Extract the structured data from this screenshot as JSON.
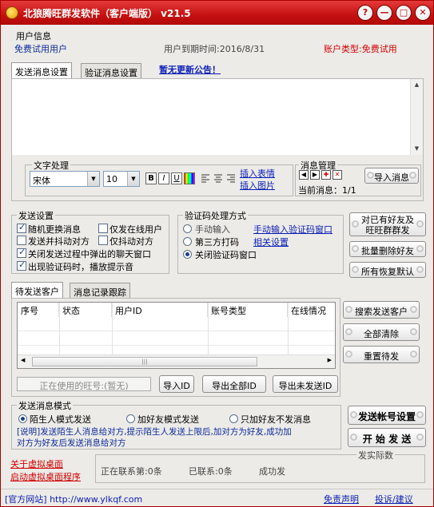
{
  "window": {
    "title": "北狼腾旺群发软件（客户端版）  v21.5",
    "controls": [
      "?",
      "—",
      "□",
      "✕"
    ]
  },
  "user_info": {
    "heading": "用户信息",
    "user": "免费试用用户",
    "expiry": "用户到期时间:2016/8/31",
    "account_type": "账户类型:免费试用"
  },
  "msg_tabs": [
    {
      "label": "发送消息设置",
      "active": true
    },
    {
      "label": "验证消息设置",
      "active": false
    }
  ],
  "announcement": "暂无更新公告！",
  "message_body": "",
  "text_format": {
    "heading": "文字处理",
    "font": "宋体",
    "size": "10",
    "buttons": [
      "B",
      "I",
      "U"
    ],
    "insert_emoji": "插入表情",
    "insert_image": "插入图片"
  },
  "msg_manage": {
    "heading": "消息管理",
    "import_button": "导入消息",
    "current": "当前消息：1/1"
  },
  "send_settings": {
    "heading": "发送设置",
    "options": [
      {
        "label": "随机更换消息",
        "checked": true
      },
      {
        "label": "仅发在线用户",
        "checked": false
      },
      {
        "label": "发送并抖动对方",
        "checked": false
      },
      {
        "label": "仅抖动对方",
        "checked": false
      },
      {
        "label": "关闭发送过程中弹出的聊天窗口",
        "checked": true
      },
      {
        "label": "出现验证码时，播放提示音",
        "checked": true
      }
    ]
  },
  "captcha": {
    "heading": "验证码处理方式",
    "options": [
      {
        "label": "手动输入",
        "checked": false
      },
      {
        "label": "第三方打码",
        "checked": false
      },
      {
        "label": "关闭验证码窗口",
        "checked": true
      }
    ],
    "manual_link": "手动输入验证码窗口",
    "settings_link": "相关设置"
  },
  "side_buttons": {
    "send_friends_line1": "对已有好友及",
    "send_friends_line2": "旺旺群群发",
    "batch_delete": "批量删除好友",
    "restore_default": "所有恢复默认"
  },
  "list_tabs": [
    {
      "label": "待发送客户",
      "active": true
    },
    {
      "label": "消息记录跟踪",
      "active": false
    }
  ],
  "table": {
    "columns": [
      "序号",
      "状态",
      "用户ID",
      "账号类型",
      "在线情况"
    ],
    "rows": []
  },
  "list_buttons": {
    "search": "搜索发送客户",
    "clear": "全部清除",
    "reset": "重置待发"
  },
  "bottom_bar": {
    "current_wangwang": "正在使用的旺号:(暂无)",
    "import_id": "导入ID",
    "export_all": "导出全部ID",
    "export_unsent": "导出未发送ID"
  },
  "send_mode": {
    "heading": "发送消息模式",
    "options": [
      {
        "label": "陌生人模式发送",
        "checked": true
      },
      {
        "label": "加好友模式发送",
        "checked": false
      },
      {
        "label": "只加好友不发消息",
        "checked": false
      }
    ],
    "note_line1": "[说明]发送陌生人消息给对方,提示陌生人发送上限后,加对方为好友,成功加",
    "note_line2": "对方为好友后发送消息给对方"
  },
  "main_buttons": {
    "account_settings": "发送帐号设置",
    "start": "开 始 发 送"
  },
  "footer_links": {
    "close_desktop": "关于虚拟桌面",
    "start_desktop": "启动虚拟桌面程序"
  },
  "status": {
    "contacting": "正在联系第:0条",
    "contacted": "已联系:0条",
    "success": "成功发",
    "partial_label": "发实际数"
  },
  "footer": {
    "website": "[官方网站] http://www.ylkqf.com",
    "disclaimer": "免责声明",
    "feedback": "投诉/建议"
  }
}
